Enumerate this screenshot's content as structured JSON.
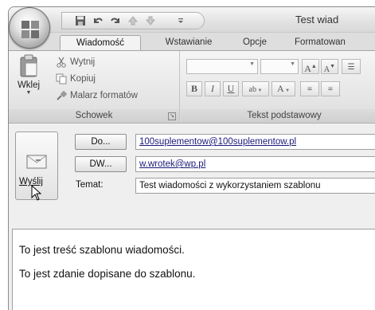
{
  "window": {
    "title": "Test wiad",
    "quick_access": [
      "save-icon",
      "undo-icon",
      "redo-icon",
      "up-arrow-icon",
      "down-arrow-icon",
      "customize-dropdown-icon"
    ]
  },
  "tabs": [
    {
      "label": "Wiadomość",
      "active": true
    },
    {
      "label": "Wstawianie",
      "active": false
    },
    {
      "label": "Opcje",
      "active": false
    },
    {
      "label": "Formatowan",
      "active": false
    }
  ],
  "ribbon": {
    "clipboard": {
      "caption": "Schowek",
      "paste_label": "Wklej",
      "cut_label": "Wytnij",
      "copy_label": "Kopiuj",
      "format_painter_label": "Malarz formatów"
    },
    "basic_text": {
      "caption": "Tekst podstawowy",
      "grow_font": "A",
      "shrink_font": "A",
      "bold": "B",
      "italic": "I",
      "underline": "U",
      "highlight": "ab",
      "font_color": "A"
    }
  },
  "compose": {
    "send_label": "Wyślij",
    "to_button_prefix": "Do",
    "to_button_suffix": "...",
    "cc_button_prefix": "DW",
    "cc_button_suffix": "...",
    "subject_label": "Temat:",
    "to_value": "100suplementow@100suplementow.pl",
    "cc_value": "w.wrotek@wp.pl",
    "subject_value": "Test wiadomości z wykorzystaniem szablonu",
    "body_lines": [
      "To jest treść szablonu wiadomości.",
      "To jest zdanie dopisane do szablonu."
    ]
  }
}
